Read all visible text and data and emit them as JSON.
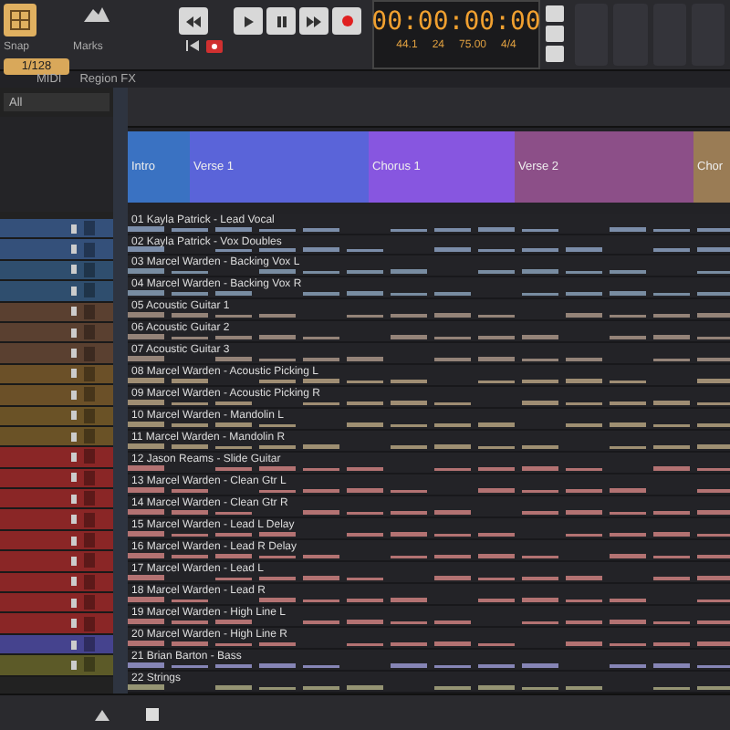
{
  "toolbar": {
    "snap_label": "Snap",
    "snap_on": true,
    "snap_value": "1/128",
    "marks_label": "Marks"
  },
  "transport": {
    "time": "00:00:00:00",
    "sample_rate": "44.1",
    "bit_depth": "24",
    "tempo": "75.00",
    "meter": "4/4",
    "record_armed": true
  },
  "menu": [
    {
      "label": "MIDI"
    },
    {
      "label": "Region FX"
    }
  ],
  "filter": {
    "value": "All"
  },
  "sections": [
    {
      "label": "Intro",
      "color": "#3a72c2"
    },
    {
      "label": "Verse 1",
      "color": "#5a64d9"
    },
    {
      "label": "Chorus 1",
      "color": "#8756e0"
    },
    {
      "label": "Verse 2",
      "color": "#8c4f88"
    },
    {
      "label": "Chor",
      "color": "#9a7c55"
    }
  ],
  "tracks": [
    {
      "name": "01 Kayla Patrick - Lead Vocal",
      "color": "#34507a"
    },
    {
      "name": "02 Kayla Patrick - Vox Doubles",
      "color": "#34507a"
    },
    {
      "name": "03 Marcel Warden - Backing Vox L",
      "color": "#2f4e6e"
    },
    {
      "name": "04 Marcel Warden - Backing Vox R",
      "color": "#2f4e6e"
    },
    {
      "name": "05 Acoustic Guitar 1",
      "color": "#5a4030"
    },
    {
      "name": "06 Acoustic Guitar 2",
      "color": "#5a4030"
    },
    {
      "name": "07 Acoustic Guitar 3",
      "color": "#5a4030"
    },
    {
      "name": "08 Marcel Warden - Acoustic Picking L",
      "color": "#6b5028"
    },
    {
      "name": "09 Marcel Warden - Acoustic Picking R",
      "color": "#6b5028"
    },
    {
      "name": "10 Marcel Warden - Mandolin L",
      "color": "#6a5226"
    },
    {
      "name": "11 Marcel Warden - Mandolin R",
      "color": "#6a5226"
    },
    {
      "name": "12 Jason Reams - Slide Guitar",
      "color": "#8a2626"
    },
    {
      "name": "13 Marcel Warden - Clean Gtr L",
      "color": "#8a2626"
    },
    {
      "name": "14 Marcel Warden - Clean Gtr R",
      "color": "#8a2626"
    },
    {
      "name": "15 Marcel Warden - Lead L Delay",
      "color": "#8a2626"
    },
    {
      "name": "16 Marcel Warden - Lead R Delay",
      "color": "#8a2626"
    },
    {
      "name": "17 Marcel Warden - Lead L",
      "color": "#8a2626"
    },
    {
      "name": "18 Marcel Warden - Lead R",
      "color": "#8a2626"
    },
    {
      "name": "19 Marcel Warden - High Line L",
      "color": "#8a2626"
    },
    {
      "name": "20 Marcel Warden - High Line R",
      "color": "#8a2626"
    },
    {
      "name": "21 Brian Barton - Bass",
      "color": "#45438e"
    },
    {
      "name": "22 Strings",
      "color": "#5c5a28"
    }
  ]
}
